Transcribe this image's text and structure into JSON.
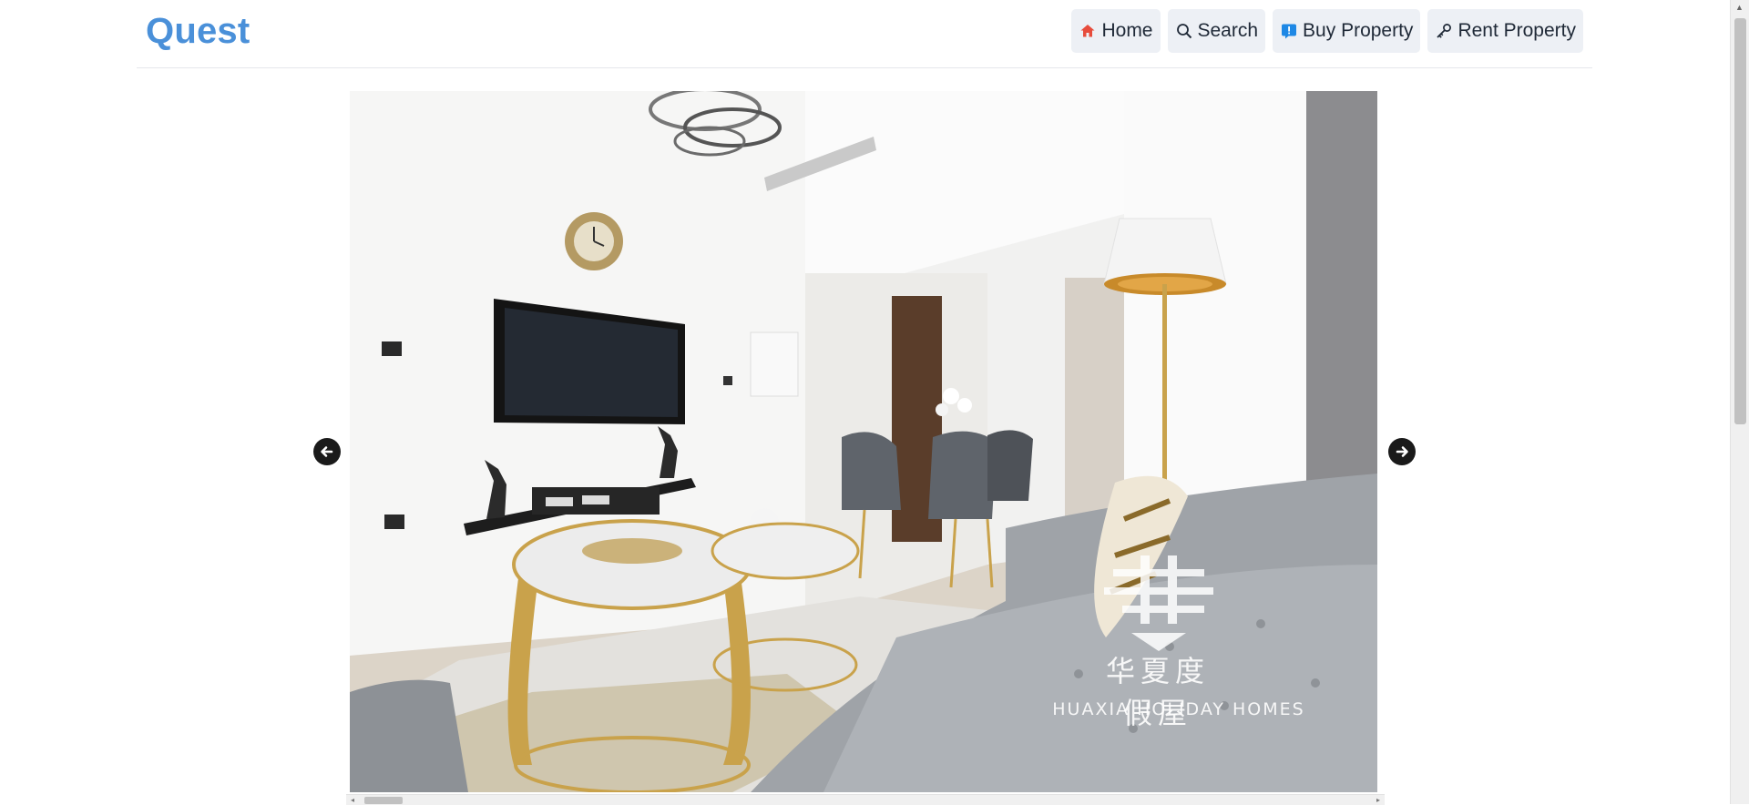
{
  "brand": {
    "name": "Quest"
  },
  "nav": {
    "items": [
      {
        "label": "Home",
        "icon": "home-icon"
      },
      {
        "label": "Search",
        "icon": "search-icon"
      },
      {
        "label": "Buy Property",
        "icon": "info-icon"
      },
      {
        "label": "Rent Property",
        "icon": "key-icon"
      }
    ]
  },
  "carousel": {
    "watermark_cn": "华夏度假屋",
    "watermark_en": "HUAXIA HOLIDAY HOMES",
    "prev_icon": "arrow-left-icon",
    "next_icon": "arrow-right-icon"
  },
  "colors": {
    "brand": "#4a90d9",
    "nav_bg": "#edf0f5",
    "arrow_bg": "#1a1a1a",
    "home_icon": "#e74c3c",
    "info_icon": "#1e88e5"
  }
}
